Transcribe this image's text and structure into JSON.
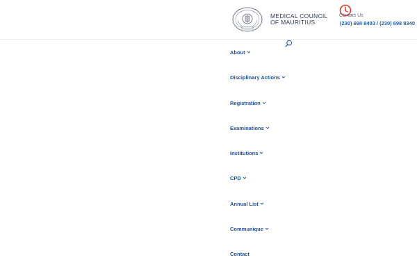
{
  "header": {
    "org_name_line1": "MEDICAL COUNCIL",
    "org_name_line2": "OF MAURITIUS",
    "contact_label": "Contact Us",
    "contact_phones": "(230) 698 8403 / (230) 698 8340"
  },
  "icons": {
    "seal": "seal-logo",
    "clock": "clock-icon",
    "search": "search-icon",
    "chevron": "chevron-down-icon"
  },
  "colors": {
    "clock": "#e0352b",
    "menu_text": "#1e4f9a",
    "phone_text": "#1e5fae",
    "logo_text": "#2c3a56"
  },
  "nav": {
    "items": [
      {
        "label": "About",
        "has_dropdown": true
      },
      {
        "label": "Disciplinary Actions",
        "has_dropdown": true
      },
      {
        "label": "Registration",
        "has_dropdown": true
      },
      {
        "label": "Examinations",
        "has_dropdown": true
      },
      {
        "label": "Institutions",
        "has_dropdown": true
      },
      {
        "label": "CPD",
        "has_dropdown": true
      },
      {
        "label": "Annual List",
        "has_dropdown": true
      },
      {
        "label": "Communique",
        "has_dropdown": true
      },
      {
        "label": "Contact",
        "has_dropdown": false
      }
    ]
  }
}
